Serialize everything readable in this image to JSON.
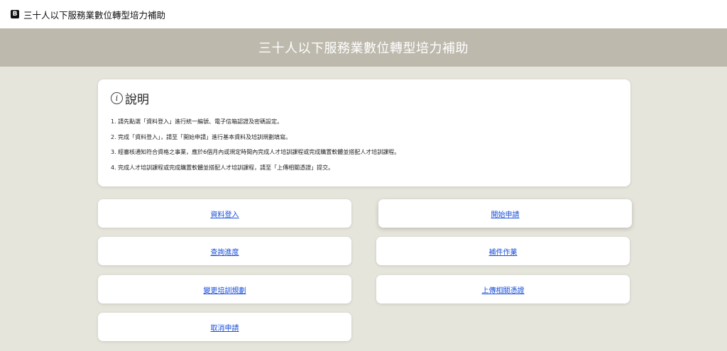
{
  "topbar": {
    "badge": "B",
    "title": "三十人以下服務業數位轉型培力補助"
  },
  "banner": {
    "title": "三十人以下服務業數位轉型培力補助"
  },
  "info": {
    "icon": "info-icon",
    "heading": "說明",
    "items": [
      "1. 請先點選「資料登入」進行統一編號、電子信箱認證及密碼設定。",
      "2. 完成「資料登入」，請至「開始申請」進行基本資料及培訓規劃填寫。",
      "3. 經審核通知符合資格之事業，應於6個月內或規定時間內完成人才培訓課程或完成購置軟體並搭配人才培訓課程。",
      "4. 完成人才培訓課程或完成購置軟體並搭配人才培訓課程，請至「上傳相關憑證」提交。"
    ]
  },
  "actions": {
    "login": "資料登入",
    "apply": "開始申請",
    "progress": "查詢進度",
    "supplement": "補件作業",
    "change_plan": "變更培訓規劃",
    "upload": "上傳相關憑證",
    "cancel": "取消申請"
  },
  "colors": {
    "banner_bg": "#bdb9ad",
    "page_bg": "#e6e5dc",
    "link": "#1a4fd8"
  }
}
